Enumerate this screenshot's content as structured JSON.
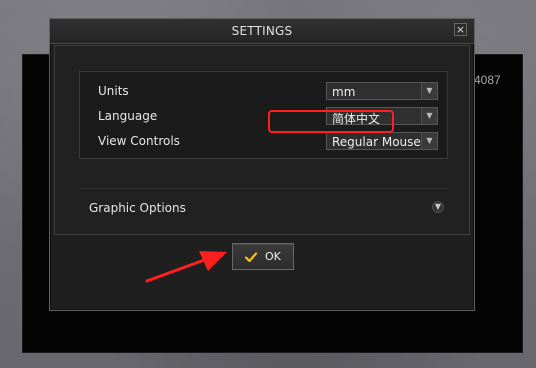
{
  "background": {
    "counter_text": "4087"
  },
  "dialog": {
    "title": "SETTINGS",
    "close_label": "×",
    "settings": [
      {
        "label": "Units",
        "value": "mm"
      },
      {
        "label": "Language",
        "value": "简体中文"
      },
      {
        "label": "View Controls",
        "value": "Regular Mouse"
      }
    ],
    "graphic_options_label": "Graphic Options",
    "ok_label": "OK"
  },
  "icons": {
    "dropdown": "chevron-down-icon",
    "expand": "chevron-down-circle-icon",
    "ok": "checkmark-icon",
    "close": "close-icon",
    "annotation_arrow": "arrow-annotation"
  },
  "colors": {
    "accent_red": "#ff1f1f",
    "accent_yellow": "#f2c12e"
  }
}
